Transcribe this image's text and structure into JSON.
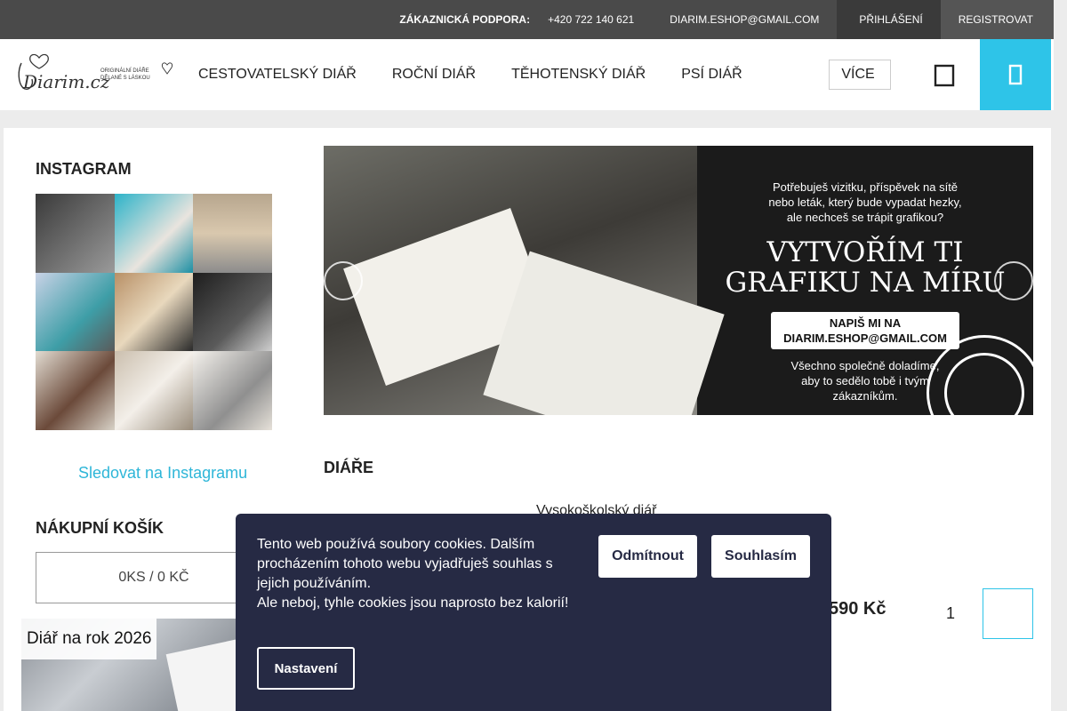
{
  "topbar": {
    "support_label": "ZÁKAZNICKÁ PODPORA:",
    "phone": "+420 722 140 621",
    "email": "DIARIM.ESHOP@GMAIL.COM",
    "login_icon": " ",
    "login": "PŘIHLÁŠENÍ",
    "register": "REGISTROVAT"
  },
  "header": {
    "logo_text": "Diarim.cz",
    "logo_tagline": "ORIGINÁLNÍ DIÁŘE DĚLANÉ S LÁSKOU",
    "nav": [
      "CESTOVATELSKÝ DIÁŘ",
      "ROČNÍ DIÁŘ",
      "TĚHOTENSKÝ DIÁŘ",
      "PSÍ DIÁŘ"
    ],
    "more_label": "VÍCE",
    "more_caret": " ",
    "user_icon": " ",
    "cart_icon": " "
  },
  "sidebar": {
    "instagram_title": "INSTAGRAM",
    "follow_icon": " ",
    "follow_label": "Sledovat na Instagramu",
    "cart_title": "NÁKUPNÍ KOŠÍK",
    "cart_summary": "0KS / 0 KČ",
    "promo_label": "Diář na rok 2026"
  },
  "banner": {
    "prev_icon": " ",
    "next_icon": " ",
    "line1": "Potřebuješ vizitku, příspěvek na sítě",
    "line2": "nebo leták, který bude vypadat hezky,",
    "line3": "ale nechceš se trápit grafikou?",
    "big1": "VYTVOŘÍM TI",
    "big2": "GRAFIKU NA MÍRU",
    "pill1": "NAPIŠ MI NA",
    "pill2": "DIARIM.ESHOP@GMAIL.COM",
    "end1": "Všechno společně doladíme,",
    "end2": "aby to sedělo tobě i tvým",
    "end3": "zákazníkům."
  },
  "main": {
    "section_title": "DIÁŘE",
    "product_name": "Vysokoškolský diář",
    "price": "590 Kč",
    "quantity": "1",
    "qty_up": " ",
    "qty_down": " ",
    "add_icon": " "
  },
  "cookie": {
    "text1": "Tento web používá soubory cookies. Dalším procházením tohoto webu vyjadřuješ souhlas s jejich používáním.",
    "text2": "Ale neboj, tyhle cookies jsou naprosto bez kalorií! ",
    "decline": "Odmítnout",
    "accept": "Souhlasím",
    "settings": "Nastavení"
  },
  "colors": {
    "accent": "#2ec4e8",
    "topbar": "#4a4a4a",
    "cookie_bg": "#262a44"
  }
}
